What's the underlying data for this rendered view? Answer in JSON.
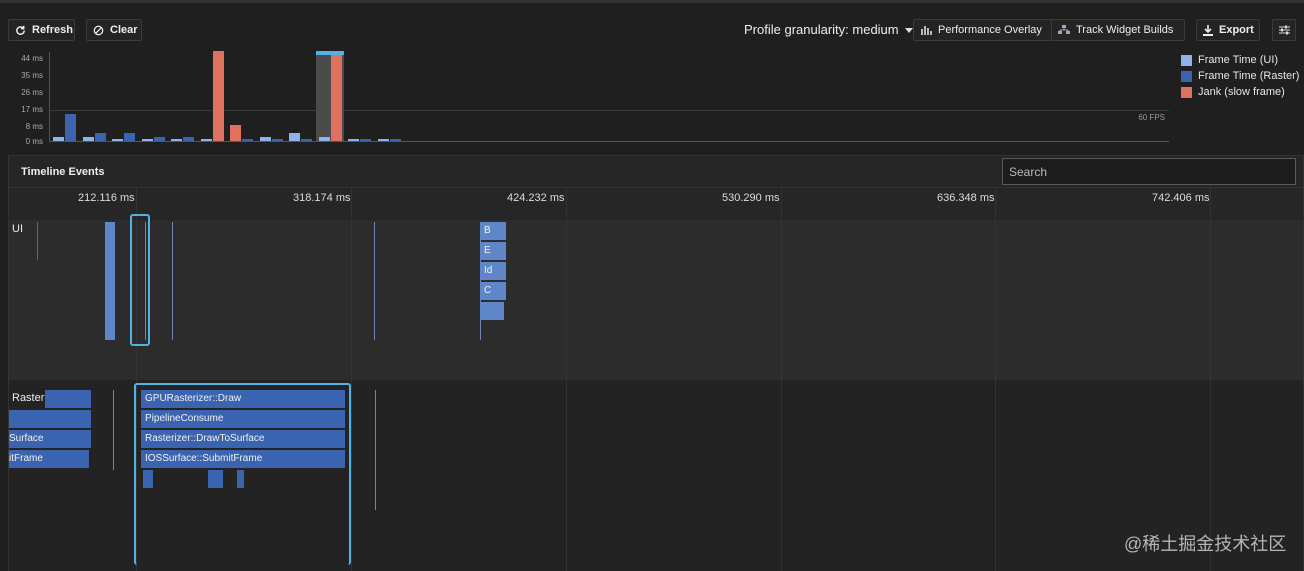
{
  "toolbar": {
    "refresh_label": "Refresh",
    "clear_label": "Clear",
    "granularity_label": "Profile granularity: medium",
    "performance_overlay_label": "Performance Overlay",
    "track_widget_builds_label": "Track Widget Builds",
    "export_label": "Export"
  },
  "frames_chart": {
    "y_ticks": [
      "44 ms",
      "35 ms",
      "26 ms",
      "17 ms",
      "8 ms",
      "0 ms"
    ],
    "fps_label": "60 FPS",
    "legend": [
      {
        "label": "Frame Time (UI)",
        "color": "#8fb3e8"
      },
      {
        "label": "Frame Time (Raster)",
        "color": "#3a63b0"
      },
      {
        "label": "Jank (slow frame)",
        "color": "#e0715f"
      }
    ]
  },
  "chart_data": {
    "type": "bar",
    "title": "",
    "ylabel": "",
    "ylim": [
      0,
      44
    ],
    "series": [
      {
        "name": "Frame Time (UI)",
        "values": [
          2,
          2,
          1,
          1,
          1,
          1,
          1,
          2,
          4,
          2,
          1,
          1
        ]
      },
      {
        "name": "Frame Time (Raster)",
        "values": [
          13,
          4,
          4,
          2,
          2,
          44,
          1,
          1,
          1,
          42,
          1,
          1
        ]
      },
      {
        "name": "Jank (slow frame)",
        "values": [
          0,
          0,
          0,
          0,
          0,
          44,
          0,
          0,
          0,
          42,
          0,
          0
        ]
      }
    ],
    "jank_ui": [
      0,
      0,
      0,
      0,
      0,
      0,
      8,
      0,
      0,
      0,
      0,
      0
    ],
    "selected_index": 9
  },
  "timeline": {
    "title": "Timeline Events",
    "search_placeholder": "Search",
    "ticks": [
      "212.116 ms",
      "318.174 ms",
      "424.232 ms",
      "530.290 ms",
      "636.348 ms",
      "742.406 ms"
    ],
    "ui_label": "UI",
    "raster_label": "Raster",
    "ui_events": [
      "B",
      "E",
      "Id",
      "C"
    ],
    "raster_events": [
      "GPURasterizer::Draw",
      "PipelineConsume",
      "Rasterizer::DrawToSurface",
      "IOSSurface::SubmitFrame"
    ],
    "raster_left_events": [
      "",
      "",
      "Surface",
      "itFrame"
    ]
  },
  "watermark": "@稀土掘金技术社区"
}
